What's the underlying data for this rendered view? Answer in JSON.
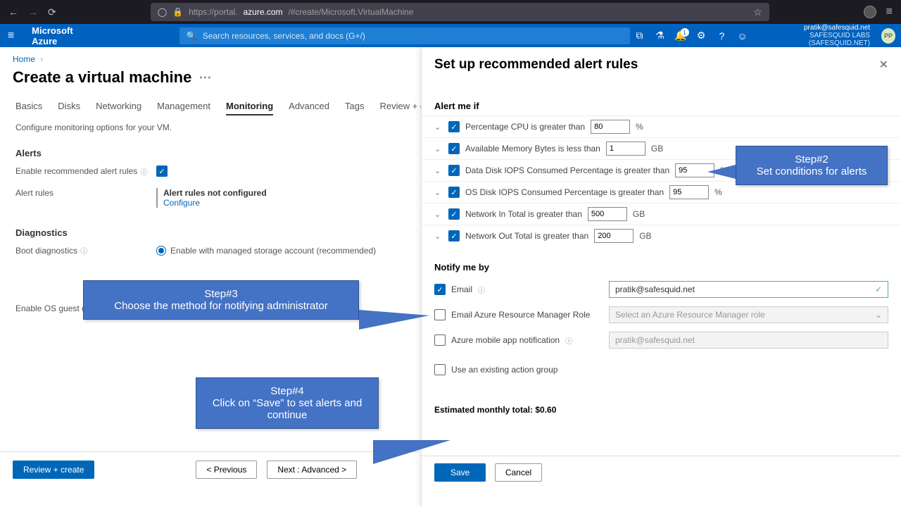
{
  "browser": {
    "url_prefix": "https://portal.",
    "url_domain": "azure.com",
    "url_path": "/#create/Microsoft.VirtualMachine"
  },
  "banner": {
    "brand": "Microsoft Azure",
    "search_placeholder": "Search resources, services, and docs (G+/)",
    "bell_count": "1",
    "user_email": "pratik@safesquid.net",
    "user_org": "SAFESQUID LABS (SAFESQUID.NET)",
    "avatar_initials": "PP"
  },
  "breadcrumb": {
    "home": "Home"
  },
  "page": {
    "title": "Create a virtual machine"
  },
  "tabs": [
    "Basics",
    "Disks",
    "Networking",
    "Management",
    "Monitoring",
    "Advanced",
    "Tags",
    "Review + create"
  ],
  "active_tab": "Monitoring",
  "body": {
    "intro": "Configure monitoring options for your VM.",
    "alerts_head": "Alerts",
    "enable_recommended": "Enable recommended alert rules",
    "alert_rules_lbl": "Alert rules",
    "alert_rules_val": "Alert rules not configured",
    "configure": "Configure",
    "diagnostics_head": "Diagnostics",
    "boot_diag": "Boot diagnostics",
    "boot_opt1": "Enable with managed storage account (recommended)",
    "os_guest": "Enable OS guest di"
  },
  "footer": {
    "review": "Review + create",
    "prev": "< Previous",
    "next": "Next : Advanced >"
  },
  "panel": {
    "title": "Set up recommended alert rules",
    "alert_me": "Alert me if",
    "conditions": [
      {
        "label": "Percentage CPU is greater than",
        "value": "80",
        "unit": "%"
      },
      {
        "label": "Available Memory Bytes is less than",
        "value": "1",
        "unit": "GB"
      },
      {
        "label": "Data Disk IOPS Consumed Percentage is greater than",
        "value": "95",
        "unit": "%"
      },
      {
        "label": "OS Disk IOPS Consumed Percentage is greater than",
        "value": "95",
        "unit": "%"
      },
      {
        "label": "Network In Total is greater than",
        "value": "500",
        "unit": "GB"
      },
      {
        "label": "Network Out Total is greater than",
        "value": "200",
        "unit": "GB"
      }
    ],
    "notify_head": "Notify me by",
    "notify": {
      "email_lbl": "Email",
      "email_val": "pratik@safesquid.net",
      "arm_lbl": "Email Azure Resource Manager Role",
      "arm_placeholder": "Select an Azure Resource Manager role",
      "mobile_lbl": "Azure mobile app notification",
      "mobile_placeholder": "pratik@safesquid.net",
      "existing_lbl": "Use an existing action group"
    },
    "estimated": "Estimated monthly total: $0.60",
    "save": "Save",
    "cancel": "Cancel"
  },
  "callouts": {
    "c2a": "Step#2",
    "c2b": "Set conditions for alerts",
    "c3a": "Step#3",
    "c3b": "Choose the method for notifying administrator",
    "c4a": "Step#4",
    "c4b": "Click on “Save” to set alerts and continue"
  }
}
